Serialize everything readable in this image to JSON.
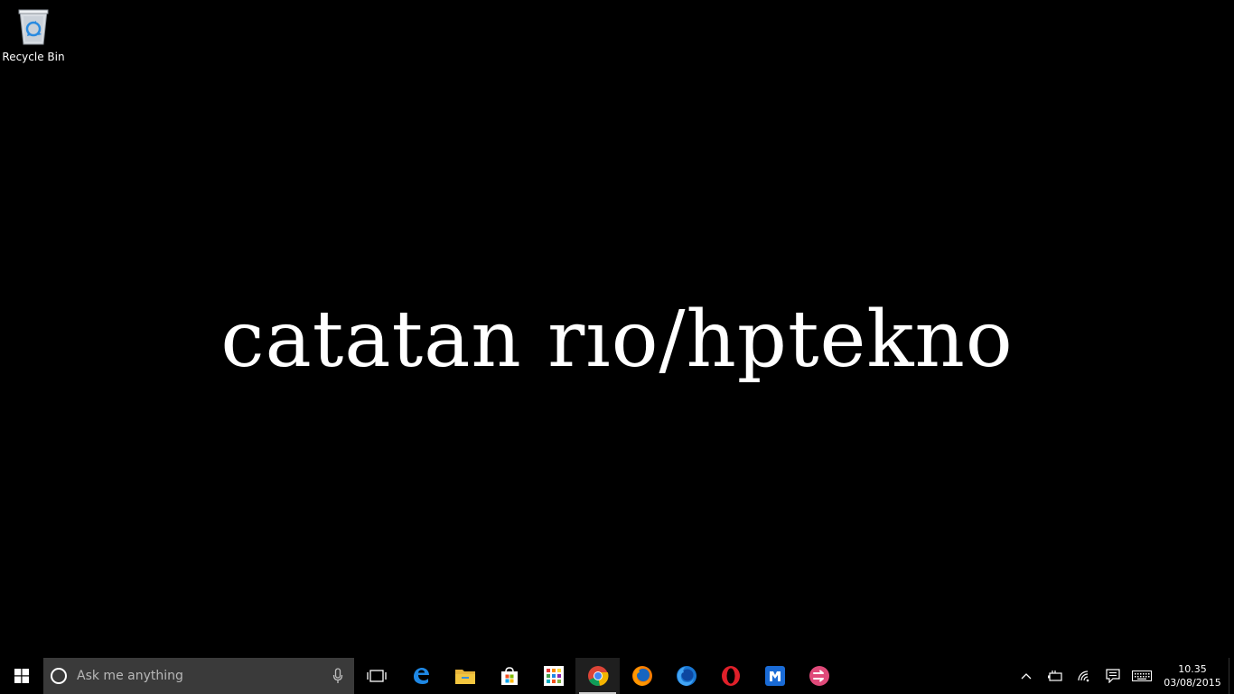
{
  "desktop": {
    "icons": [
      {
        "label": "Recycle Bin",
        "icon": "recycle-bin-icon"
      }
    ],
    "wallpaper_text": "catatan rıo/hptekno",
    "background_color": "#000000"
  },
  "taskbar": {
    "start_icon": "windows-logo-icon",
    "search": {
      "placeholder": "Ask me anything",
      "value": ""
    },
    "pinned_apps": [
      {
        "name": "Task View",
        "icon": "task-view-icon"
      },
      {
        "name": "Microsoft Edge",
        "icon": "edge-icon"
      },
      {
        "name": "File Explorer",
        "icon": "file-explorer-icon"
      },
      {
        "name": "Store",
        "icon": "store-icon"
      },
      {
        "name": "App Launcher",
        "icon": "app-grid-icon"
      },
      {
        "name": "Google Chrome",
        "icon": "chrome-icon",
        "active": true
      },
      {
        "name": "Firefox",
        "icon": "firefox-icon"
      },
      {
        "name": "Firefox Developer",
        "icon": "firefox-blue-icon"
      },
      {
        "name": "Opera",
        "icon": "opera-icon"
      },
      {
        "name": "Maxthon",
        "icon": "maxthon-icon"
      },
      {
        "name": "Pink App",
        "icon": "pink-arrow-icon"
      }
    ],
    "tray": {
      "icons": [
        "chevron-up-icon",
        "battery-icon",
        "wifi-icon",
        "action-center-icon",
        "keyboard-icon"
      ],
      "time": "10.35",
      "date": "03/08/2015"
    },
    "accent_colors": {
      "search_bg": "#3a3a3a",
      "edge": "#1e88e5",
      "explorer": "#f3c63f",
      "chrome_red": "#db4437",
      "opera": "#e0202a",
      "maxthon": "#1a6bd6",
      "pink": "#e04a7a"
    }
  }
}
